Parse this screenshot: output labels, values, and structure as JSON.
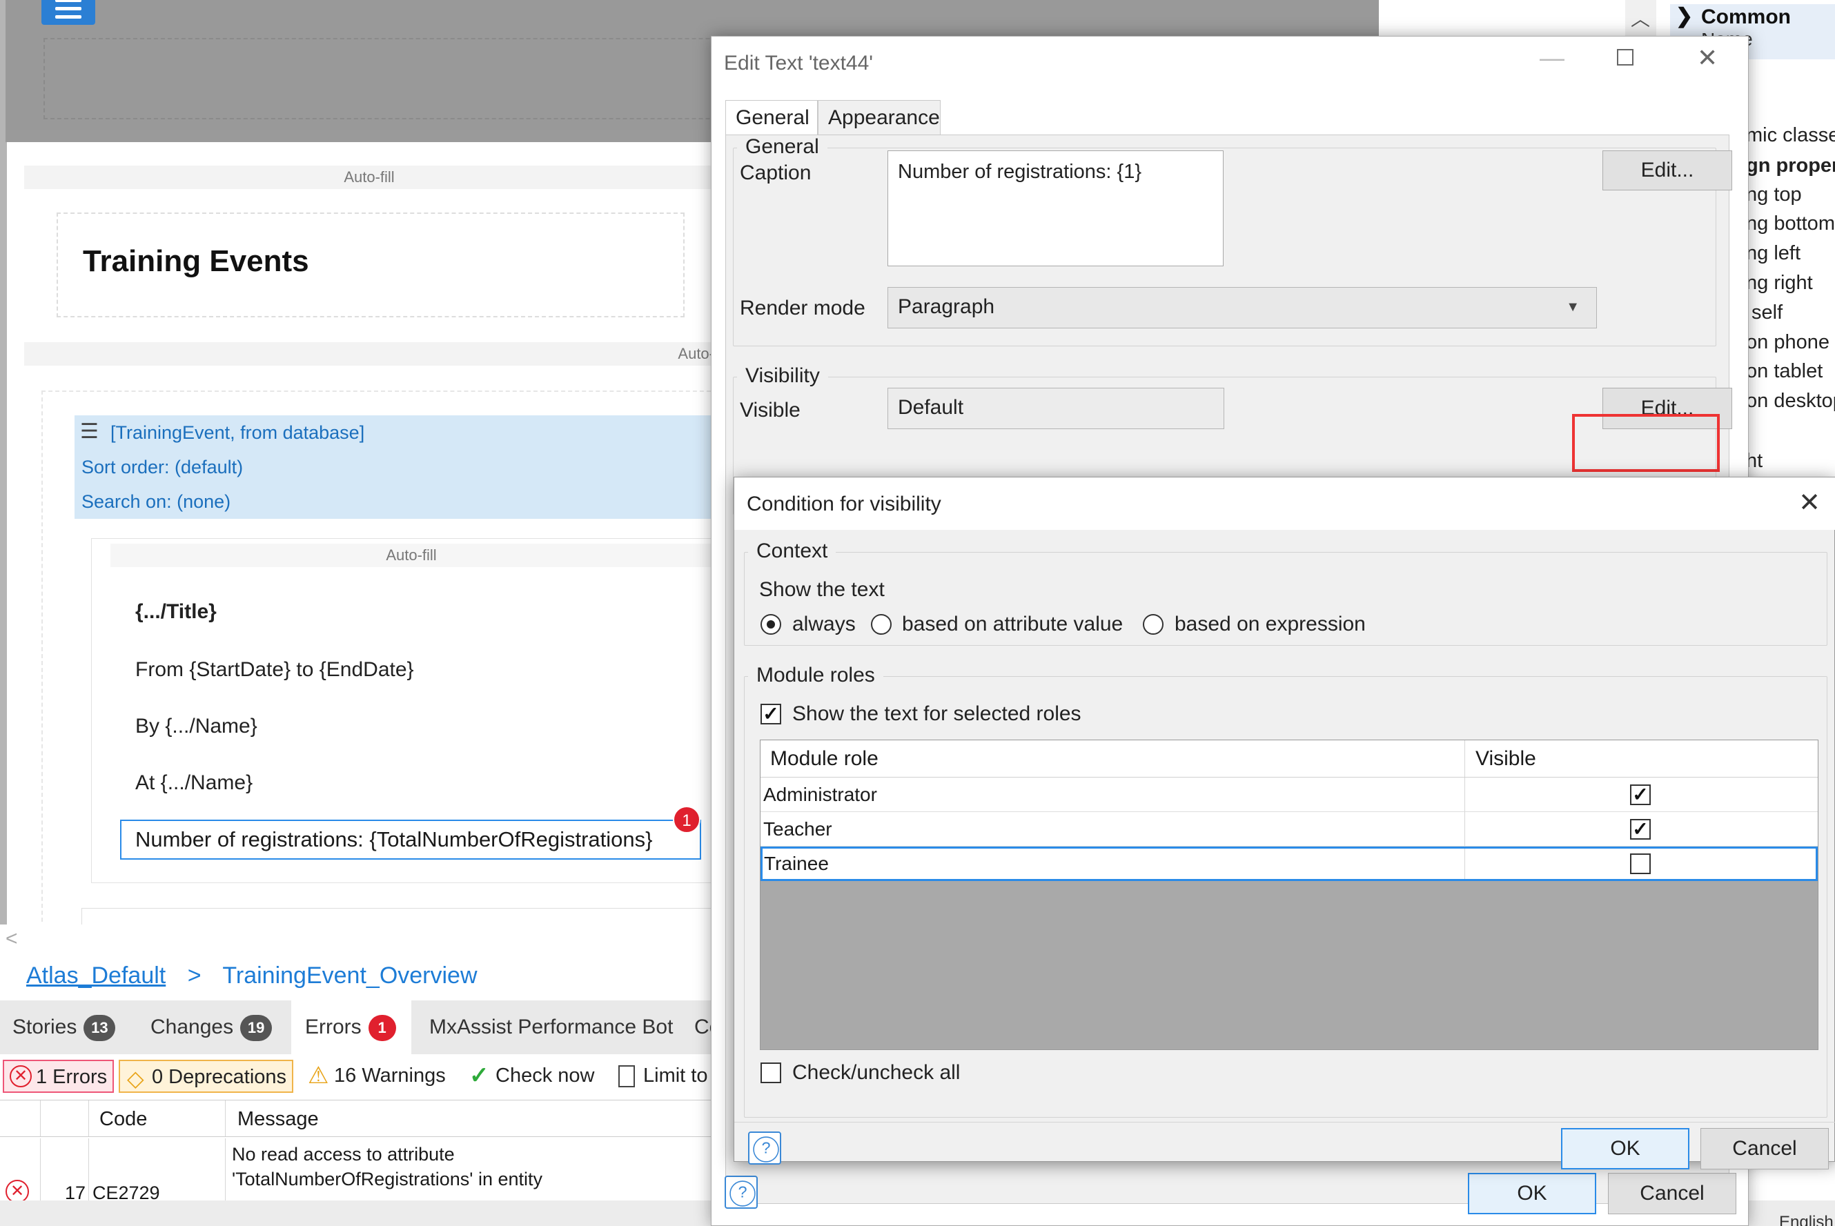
{
  "canvas": {
    "autofill_1": "Auto-fill",
    "autofill_2": "Auto-",
    "autofill_3": "Auto-fill",
    "page_heading": "Training Events",
    "listview": {
      "source": "[TrainingEvent, from database]",
      "sort": "Sort order: (default)",
      "search": "Search on: (none)"
    },
    "item_title": "{.../Title}",
    "item_dates": "From {StartDate} to {EndDate}",
    "item_by": "By {.../Name}",
    "item_at": "At {.../Name}",
    "item_count": "Number of registrations: {TotalNumberOfRegistrations}",
    "error_badge": "1"
  },
  "bottom_panel": {
    "breadcrumb": [
      "Atlas_Default",
      ">",
      "TrainingEvent_Overview"
    ],
    "tabs": [
      {
        "label": "Stories",
        "count": "13"
      },
      {
        "label": "Changes",
        "count": "19"
      },
      {
        "label": "Errors",
        "count": "1"
      },
      {
        "label": "MxAssist Performance Bot"
      },
      {
        "label": "Co"
      }
    ],
    "filters": {
      "errors": "1 Errors",
      "deprecations": "0 Deprecations",
      "warnings": "16 Warnings",
      "check_now": "Check now",
      "limit": "Limit to"
    },
    "columns": [
      "Code",
      "Message"
    ],
    "row": {
      "number": "17",
      "code": "CE2729",
      "message_line1": "No read access to attribute",
      "message_line2": "'TotalNumberOfRegistrations' in entity"
    }
  },
  "properties": {
    "section": "Common",
    "partial": "Name",
    "lines": [
      "mic classes",
      "gn proper",
      "ng top",
      "ng bottom",
      "ng left",
      "ng right",
      "self",
      "on phone",
      "on tablet",
      "on desktop",
      "ht"
    ],
    "status": "English"
  },
  "edit_dialog": {
    "title": "Edit Text 'text44'",
    "tabs": [
      "General",
      "Appearance"
    ],
    "group_general": "General",
    "caption_label": "Caption",
    "caption_value": "Number of registrations: {1}",
    "caption_edit": "Edit...",
    "render_label": "Render mode",
    "render_value": "Paragraph",
    "group_visibility": "Visibility",
    "visible_label": "Visible",
    "visible_value": "Default",
    "visible_edit": "Edit...",
    "ok": "OK",
    "cancel": "Cancel"
  },
  "condition_dialog": {
    "title": "Condition for visibility",
    "group_context": "Context",
    "show_text": "Show the text",
    "options": [
      "always",
      "based on attribute value",
      "based on expression"
    ],
    "selected_option": "always",
    "group_roles": "Module roles",
    "show_for_roles": "Show the text for selected roles",
    "show_for_roles_checked": true,
    "columns": [
      "Module role",
      "Visible"
    ],
    "roles": [
      {
        "name": "Administrator",
        "visible": true
      },
      {
        "name": "Teacher",
        "visible": true
      },
      {
        "name": "Trainee",
        "visible": false
      }
    ],
    "check_all": "Check/uncheck all",
    "ok": "OK",
    "cancel": "Cancel"
  },
  "colors": {
    "accent": "#2a8be8",
    "error": "#e0202e",
    "highlight": "#e33333",
    "listview_band": "#d5e8f7"
  }
}
